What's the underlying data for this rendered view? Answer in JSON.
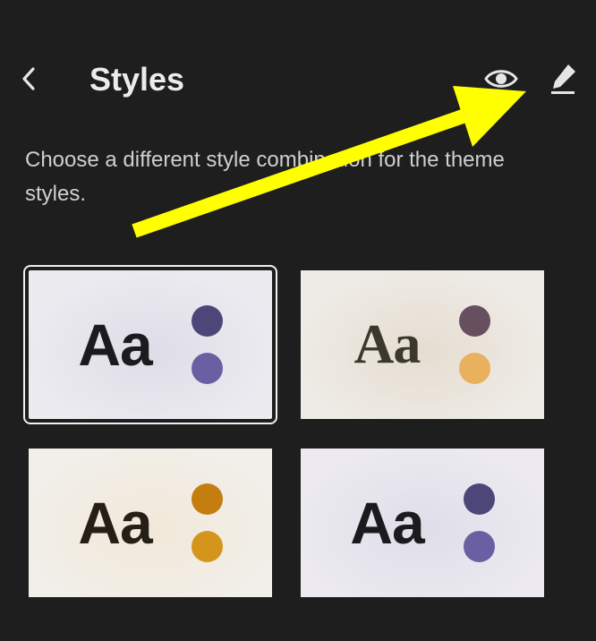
{
  "header": {
    "title": "Styles",
    "back_icon": "chevron-left-icon",
    "preview_icon": "eye-icon",
    "edit_icon": "pencil-icon"
  },
  "description": "Choose a different style combination for the theme styles.",
  "styles": [
    {
      "sample": "Aa",
      "font": "sans",
      "selected": true,
      "background": [
        "#ecebf0",
        "#dedde7"
      ],
      "text_color": "#1b1b1f",
      "colors": [
        "#4d4679",
        "#6b5fa3"
      ]
    },
    {
      "sample": "Aa",
      "font": "serif",
      "selected": false,
      "background": [
        "#eeebe6",
        "#e6ddd0"
      ],
      "text_color": "#3b382c",
      "colors": [
        "#664f5f",
        "#e9b05e"
      ]
    },
    {
      "sample": "Aa",
      "font": "sans",
      "selected": false,
      "background": [
        "#f1efe9",
        "#f2e8d8"
      ],
      "text_color": "#251f15",
      "colors": [
        "#c47e10",
        "#d5951d"
      ]
    },
    {
      "sample": "Aa",
      "font": "sans",
      "selected": false,
      "background": [
        "#eceaf0",
        "#dfdde7"
      ],
      "text_color": "#1b1b1f",
      "colors": [
        "#4d4679",
        "#6b5fa3"
      ]
    }
  ],
  "annotation": {
    "color": "#ffff00"
  }
}
